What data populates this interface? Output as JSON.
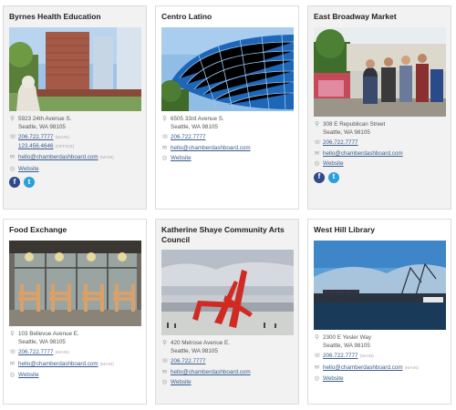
{
  "cards": [
    {
      "title": "Byrnes Health Education",
      "address1": "5923 24th Avenue S.",
      "address2": "Seattle, WA 98105",
      "phones": [
        {
          "number": "206.722.7777",
          "tag": "(MAIN)"
        },
        {
          "number": "123.456.4646",
          "tag": "(OFFICE)"
        }
      ],
      "email": "hello@chamberdashboard.com",
      "email_tag": "(MAIN)",
      "website": "Website",
      "social": [
        "f",
        "t"
      ]
    },
    {
      "title": "Centro Latino",
      "address1": "6505 33rd Avenue S.",
      "address2": "Seattle, WA 98105",
      "phones": [
        {
          "number": "206.722.7777",
          "tag": ""
        }
      ],
      "email": "hello@chamberdashboard.com",
      "email_tag": "",
      "website": "Website",
      "social": []
    },
    {
      "title": "East Broadway Market",
      "address1": "308 E Republican Street",
      "address2": "Seattle, WA 98105",
      "phones": [
        {
          "number": "206.722.7777",
          "tag": ""
        }
      ],
      "email": "hello@chamberdashboard.com",
      "email_tag": "",
      "website": "Website",
      "social": [
        "f",
        "t"
      ]
    },
    {
      "title": "Food Exchange",
      "address1": "103 Bellevue Avenue E.",
      "address2": "Seattle, WA 98105",
      "phones": [
        {
          "number": "206.722.7777",
          "tag": "(MAIN)"
        }
      ],
      "email": "hello@chamberdashboard.com",
      "email_tag": "(MAIN)",
      "website": "Website",
      "social": []
    },
    {
      "title": "Katherine Shaye Community Arts Council",
      "address1": "420 Melrose Avenue E.",
      "address2": "Seattle, WA 98105",
      "phones": [
        {
          "number": "206.722.7777",
          "tag": ""
        }
      ],
      "email": "hello@chamberdashboard.com",
      "email_tag": "",
      "website": "Website",
      "social": []
    },
    {
      "title": "West Hill Library",
      "address1": "2300 E Yesler Way",
      "address2": "Seattle, WA 98105",
      "phones": [
        {
          "number": "206.722.7777",
          "tag": "(MAIN)"
        }
      ],
      "email": "hello@chamberdashboard.com",
      "email_tag": "(MAIN)",
      "website": "Website",
      "social": []
    }
  ],
  "icons": {
    "pin": "location-pin-icon",
    "phone": "phone-icon",
    "email": "email-icon",
    "web": "globe-icon"
  },
  "colors": {
    "link": "#3a5d8c",
    "facebook": "#2e4a8a",
    "twitter": "#2a9fd8",
    "card_border": "#dcdcdc"
  }
}
